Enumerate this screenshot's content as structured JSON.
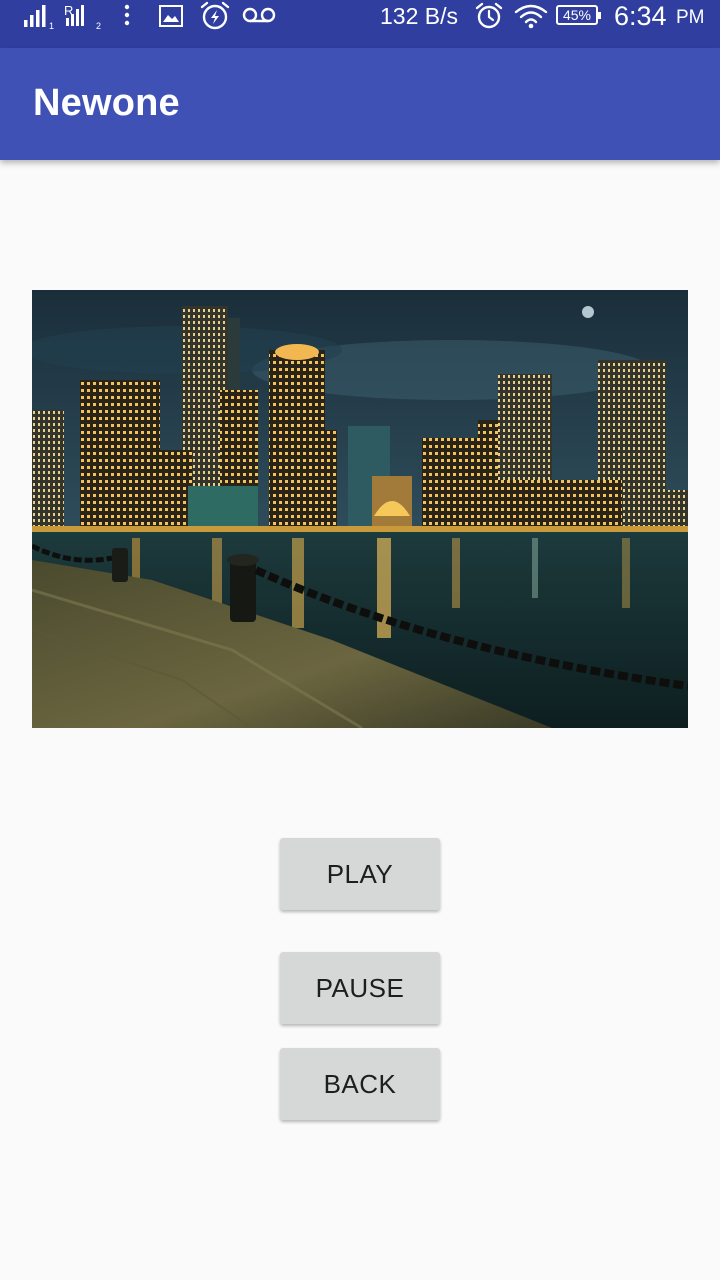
{
  "status_bar": {
    "network_speed": "132 B/s",
    "battery_percent": "45%",
    "time": "6:34",
    "ampm": "PM",
    "icons": [
      "signal-sim1-icon",
      "signal-sim2-icon",
      "overflow-dots-icon",
      "image-notification-icon",
      "alarm-notification-icon",
      "voicemail-icon",
      "alarm-clock-icon",
      "wifi-icon",
      "battery-icon"
    ]
  },
  "app_bar": {
    "title": "Newone"
  },
  "image": {
    "subject": "night-city-waterfront-photo"
  },
  "buttons": {
    "play": "PLAY",
    "pause": "PAUSE",
    "back": "BACK"
  },
  "colors": {
    "status_bar": "#303f9f",
    "app_bar": "#3f51b5",
    "background": "#fafafa",
    "button": "#d6d7d7"
  }
}
